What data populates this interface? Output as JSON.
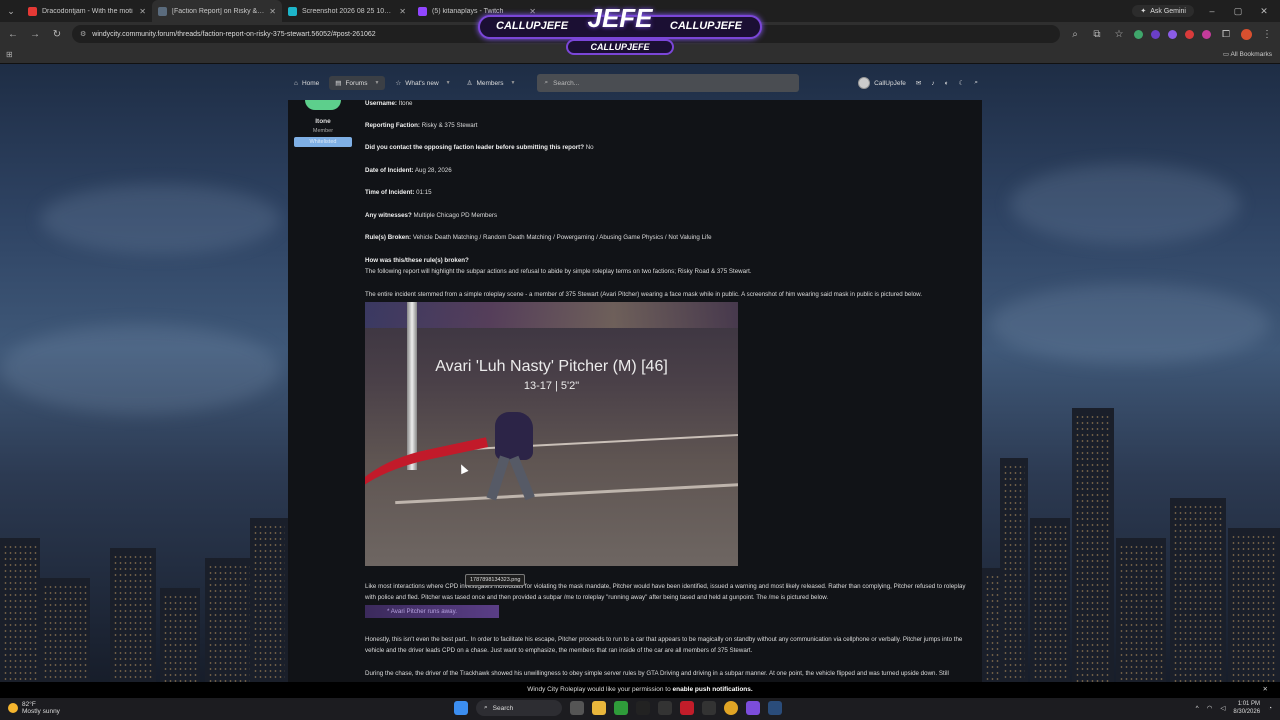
{
  "tabs": [
    {
      "title": "Dracodontjam - With the moti",
      "color": "#e53935",
      "active": false
    },
    {
      "title": "[Faction Report] on Risky & 375",
      "color": "#5a6b7d",
      "active": true
    },
    {
      "title": "Screenshot 2026 08 25 100543",
      "color": "#1db5c9",
      "active": false
    },
    {
      "title": "(5) kitanaplays - Twitch",
      "color": "#9146ff",
      "active": false
    }
  ],
  "browser": {
    "ask_gemini": "Ask Gemini",
    "url": "windycity.community.forum/threads/faction-report-on-risky-375-stewart.56052/#post-261062",
    "all_bookmarks": "All Bookmarks"
  },
  "overlay": {
    "left": "CALLUPJEFE",
    "center": "JEFE",
    "right": "CALLUPJEFE",
    "bottom": "CALLUPJEFE"
  },
  "forum_nav": {
    "home": "Home",
    "forums": "Forums",
    "whats_new": "What's new",
    "members": "Members",
    "search_placeholder": "Search...",
    "username": "CallUpJefe"
  },
  "author": {
    "name": "Itone",
    "role": "Member",
    "banner": "Whitelisted"
  },
  "post": {
    "fields": [
      {
        "label": "Username:",
        "value": "Itone"
      },
      {
        "label": "Reporting Faction:",
        "value": "Risky & 375 Stewart"
      },
      {
        "label": "Did you contact the opposing faction leader before submitting this report?",
        "value": "No"
      },
      {
        "label": "Date of Incident:",
        "value": "Aug 28, 2026"
      },
      {
        "label": "Time of Incident:",
        "value": "01:15"
      },
      {
        "label": "Any witnesses?",
        "value": "Multiple Chicago PD Members"
      },
      {
        "label": "Rule(s) Broken:",
        "value": "Vehicle Death Matching / Random Death Matching / Powergaming / Abusing Game Physics / Not Valuing Life"
      }
    ],
    "how_label": "How was this/these rule(s) broken?",
    "how_text": "The following report will highlight the subpar actions and refusal to abide by simple roleplay terms on two factions; Risky Road & 375 Stewart.",
    "para1": "The entire incident stemmed from a simple roleplay scene - a member of 375 Stewart (Avari Pitcher) wearing a face mask while in public. A screenshot of him wearing said mask in public is pictured below.",
    "screenshot_name": "Avari 'Luh Nasty' Pitcher (M) [46]",
    "screenshot_sub": "13-17 | 5'2\"",
    "tooltip": "1787898134323.png",
    "para2": "Like most interactions where CPD investigates individuals for violating the mask mandate, Pitcher would have been identified, issued a warning and most likely released. Rather than complying, Pitcher refused to roleplay with police and fled. Pitcher was tased once and then provided a subpar /me to roleplay \"running away\" after being tased and held at gunpoint. The /me is pictured below.",
    "me_text": "* Avari Pitcher runs away.",
    "para3": "Honestly, this isn't even the best part.. In order to facilitate his escape, Pitcher proceeds to run to a car that appears to be magically on standby without any communication via cellphone or verbally. Pitcher jumps into the vehicle and the driver leads CPD on a chase. Just want to emphasize, the members that ran inside of the car are all members of 375 Stewart.",
    "para4": "During the chase, the driver of the Trackhawk showed his unwillingness to obey simple server rules by GTA Driving and driving in a subpar manner. At one point, the vehicle flipped and was turned upside down. Still"
  },
  "notice": {
    "text": "Windy City Roleplay would like your permission to",
    "link": "enable push notifications."
  },
  "taskbar": {
    "temp": "82°F",
    "weather": "Mostly sunny",
    "search": "Search",
    "time": "1:01 PM",
    "date": "8/30/2026"
  }
}
